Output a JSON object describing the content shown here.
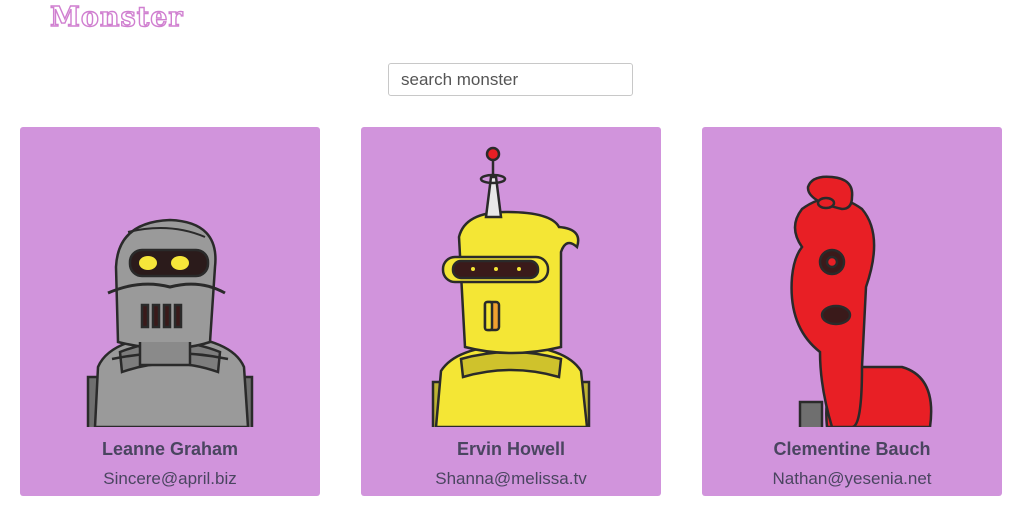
{
  "app": {
    "logo": "Monster"
  },
  "search": {
    "placeholder": "search monster",
    "value": ""
  },
  "monsters": [
    {
      "name": "Leanne Graham",
      "email": "Sincere@april.biz",
      "robot_color": "#9a9a9a"
    },
    {
      "name": "Ervin Howell",
      "email": "Shanna@melissa.tv",
      "robot_color": "#f4e635"
    },
    {
      "name": "Clementine Bauch",
      "email": "Nathan@yesenia.net",
      "robot_color": "#e81f25"
    }
  ],
  "colors": {
    "card_bg": "#d194dc",
    "logo": "#d07fd0",
    "text": "#4a4560"
  }
}
